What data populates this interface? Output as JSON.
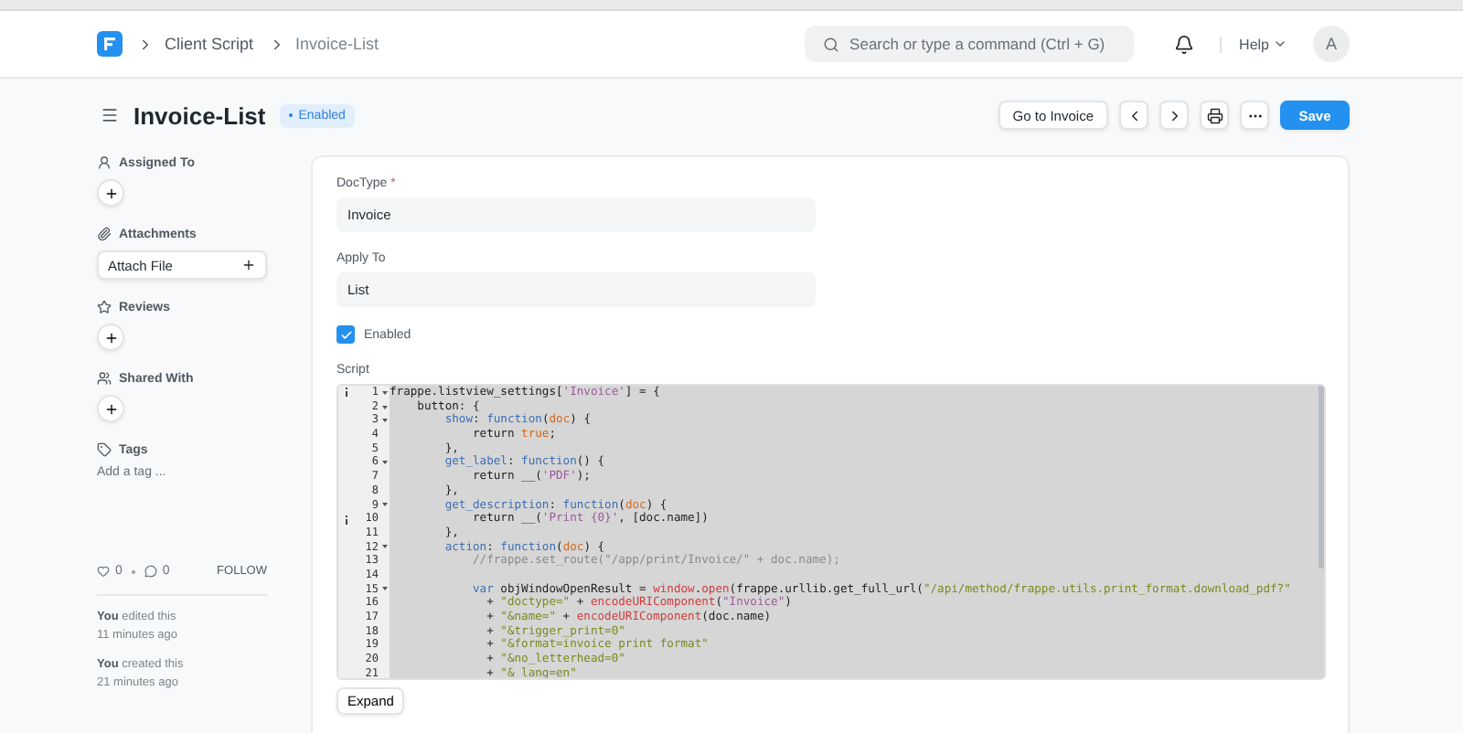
{
  "navbar": {
    "breadcrumbs": [
      "Client Script",
      "Invoice-List"
    ],
    "search": {
      "placeholder": "Search or type a command (Ctrl + G)"
    },
    "help": "Help",
    "avatar": "A"
  },
  "page_header": {
    "title": "Invoice-List",
    "status": "Enabled",
    "buttons": [
      {
        "kind": "text",
        "label": "Go to Invoice"
      },
      {
        "kind": "prev"
      },
      {
        "kind": "next"
      },
      {
        "kind": "print"
      },
      {
        "kind": "more"
      },
      {
        "kind": "primary",
        "label": "Save"
      }
    ]
  },
  "sidebar": {
    "sections": [
      {
        "title": "Assigned To",
        "kind": "add"
      },
      {
        "title": "Attachments",
        "kind": "attach",
        "action": "Attach File"
      },
      {
        "title": "Reviews",
        "kind": "add"
      },
      {
        "title": "Shared With",
        "kind": "add"
      },
      {
        "title": "Tags",
        "kind": "tags",
        "action": "Add a tag ..."
      }
    ],
    "likes": "0",
    "comments": "0",
    "follow": "FOLLOW",
    "activity": [
      {
        "actor": "You",
        "action": "edited this",
        "time": "11 minutes ago"
      },
      {
        "actor": "You",
        "action": "created this",
        "time": "21 minutes ago"
      }
    ]
  },
  "form": {
    "fields": [
      {
        "kind": "input",
        "label": "DocType",
        "required_mark": "*",
        "value": "Invoice"
      },
      {
        "kind": "input",
        "label": "Apply To",
        "value": "List"
      },
      {
        "kind": "check",
        "label": "Enabled",
        "checked": true
      }
    ],
    "script": {
      "label": "Script",
      "expand": "Expand",
      "lines": [
        {
          "number": "1",
          "fold": true,
          "info": true,
          "tokens": [
            {
              "kind": "plain",
              "text": "frappe.listview_settings["
            },
            {
              "kind": "string2",
              "text": "'Invoice'"
            },
            {
              "kind": "plain",
              "text": "] = {"
            }
          ]
        },
        {
          "number": "2",
          "fold": true,
          "info": false,
          "tokens": [
            {
              "kind": "plain",
              "text": "    button: {"
            }
          ]
        },
        {
          "number": "3",
          "fold": true,
          "info": false,
          "tokens": [
            {
              "kind": "key",
              "text": "        show"
            },
            {
              "kind": "plain",
              "text": ": "
            },
            {
              "kind": "keyword",
              "text": "function"
            },
            {
              "kind": "plain",
              "text": "("
            },
            {
              "kind": "param",
              "text": "doc"
            },
            {
              "kind": "plain",
              "text": ") {"
            }
          ]
        },
        {
          "number": "4",
          "fold": false,
          "info": false,
          "tokens": [
            {
              "kind": "plain",
              "text": "            return "
            },
            {
              "kind": "param",
              "text": "true"
            },
            {
              "kind": "plain",
              "text": ";"
            }
          ]
        },
        {
          "number": "5",
          "fold": false,
          "info": false,
          "tokens": [
            {
              "kind": "plain",
              "text": "        },"
            }
          ]
        },
        {
          "number": "6",
          "fold": true,
          "info": false,
          "tokens": [
            {
              "kind": "key",
              "text": "        get_label"
            },
            {
              "kind": "plain",
              "text": ": "
            },
            {
              "kind": "keyword",
              "text": "function"
            },
            {
              "kind": "plain",
              "text": "() {"
            }
          ]
        },
        {
          "number": "7",
          "fold": false,
          "info": false,
          "tokens": [
            {
              "kind": "plain",
              "text": "            return __("
            },
            {
              "kind": "string2",
              "text": "'PDF'"
            },
            {
              "kind": "plain",
              "text": ");"
            }
          ]
        },
        {
          "number": "8",
          "fold": false,
          "info": false,
          "tokens": [
            {
              "kind": "plain",
              "text": "        },"
            }
          ]
        },
        {
          "number": "9",
          "fold": true,
          "info": false,
          "tokens": [
            {
              "kind": "key",
              "text": "        get_description"
            },
            {
              "kind": "plain",
              "text": ": "
            },
            {
              "kind": "keyword",
              "text": "function"
            },
            {
              "kind": "plain",
              "text": "("
            },
            {
              "kind": "param",
              "text": "doc"
            },
            {
              "kind": "plain",
              "text": ") {"
            }
          ]
        },
        {
          "number": "10",
          "fold": false,
          "info": true,
          "tokens": [
            {
              "kind": "plain",
              "text": "            return __("
            },
            {
              "kind": "string2",
              "text": "'Print {0}'"
            },
            {
              "kind": "plain",
              "text": ", [doc.name])"
            }
          ]
        },
        {
          "number": "11",
          "fold": false,
          "info": false,
          "tokens": [
            {
              "kind": "plain",
              "text": "        },"
            }
          ]
        },
        {
          "number": "12",
          "fold": true,
          "info": false,
          "tokens": [
            {
              "kind": "key",
              "text": "        action"
            },
            {
              "kind": "plain",
              "text": ": "
            },
            {
              "kind": "keyword",
              "text": "function"
            },
            {
              "kind": "plain",
              "text": "("
            },
            {
              "kind": "param",
              "text": "doc"
            },
            {
              "kind": "plain",
              "text": ") {"
            }
          ]
        },
        {
          "number": "13",
          "fold": false,
          "info": false,
          "tokens": [
            {
              "kind": "comment",
              "text": "            //frappe.set_route(\"/app/print/Invoice/\" + doc.name);"
            }
          ]
        },
        {
          "number": "14",
          "fold": false,
          "info": false
        },
        {
          "number": "15",
          "fold": true,
          "info": false,
          "tokens": [
            {
              "kind": "keyword",
              "text": "            var"
            },
            {
              "kind": "plain",
              "text": " objWindowOpenResult = "
            },
            {
              "kind": "lib",
              "text": "window"
            },
            {
              "kind": "plain",
              "text": "."
            },
            {
              "kind": "lib",
              "text": "open"
            },
            {
              "kind": "plain",
              "text": "(frappe.urllib.get_full_url("
            },
            {
              "kind": "string",
              "text": "\"/api/method/frappe.utils.print_format.download_pdf?\""
            }
          ]
        },
        {
          "number": "16",
          "fold": false,
          "info": false,
          "tokens": [
            {
              "kind": "plain",
              "text": "              + "
            },
            {
              "kind": "string",
              "text": "\"doctype=\""
            },
            {
              "kind": "plain",
              "text": " + "
            },
            {
              "kind": "lib",
              "text": "encodeURIComponent"
            },
            {
              "kind": "plain",
              "text": "("
            },
            {
              "kind": "string2",
              "text": "\"Invoice\""
            },
            {
              "kind": "plain",
              "text": ")"
            }
          ]
        },
        {
          "number": "17",
          "fold": false,
          "info": false,
          "tokens": [
            {
              "kind": "plain",
              "text": "              + "
            },
            {
              "kind": "string",
              "text": "\"&name=\""
            },
            {
              "kind": "plain",
              "text": " + "
            },
            {
              "kind": "lib",
              "text": "encodeURIComponent"
            },
            {
              "kind": "plain",
              "text": "(doc.name)"
            }
          ]
        },
        {
          "number": "18",
          "fold": false,
          "info": false,
          "tokens": [
            {
              "kind": "plain",
              "text": "              + "
            },
            {
              "kind": "string",
              "text": "\"&trigger_print=0\""
            }
          ]
        },
        {
          "number": "19",
          "fold": false,
          "info": false,
          "tokens": [
            {
              "kind": "plain",
              "text": "              + "
            },
            {
              "kind": "string",
              "text": "\"&format=invoice print format\""
            }
          ]
        },
        {
          "number": "20",
          "fold": false,
          "info": false,
          "tokens": [
            {
              "kind": "plain",
              "text": "              + "
            },
            {
              "kind": "string",
              "text": "\"&no_letterhead=0\""
            }
          ]
        },
        {
          "number": "21",
          "fold": false,
          "info": false,
          "tokens": [
            {
              "kind": "plain",
              "text": "              + "
            },
            {
              "kind": "string",
              "text": "\"&_lang=en\""
            }
          ]
        }
      ]
    }
  }
}
